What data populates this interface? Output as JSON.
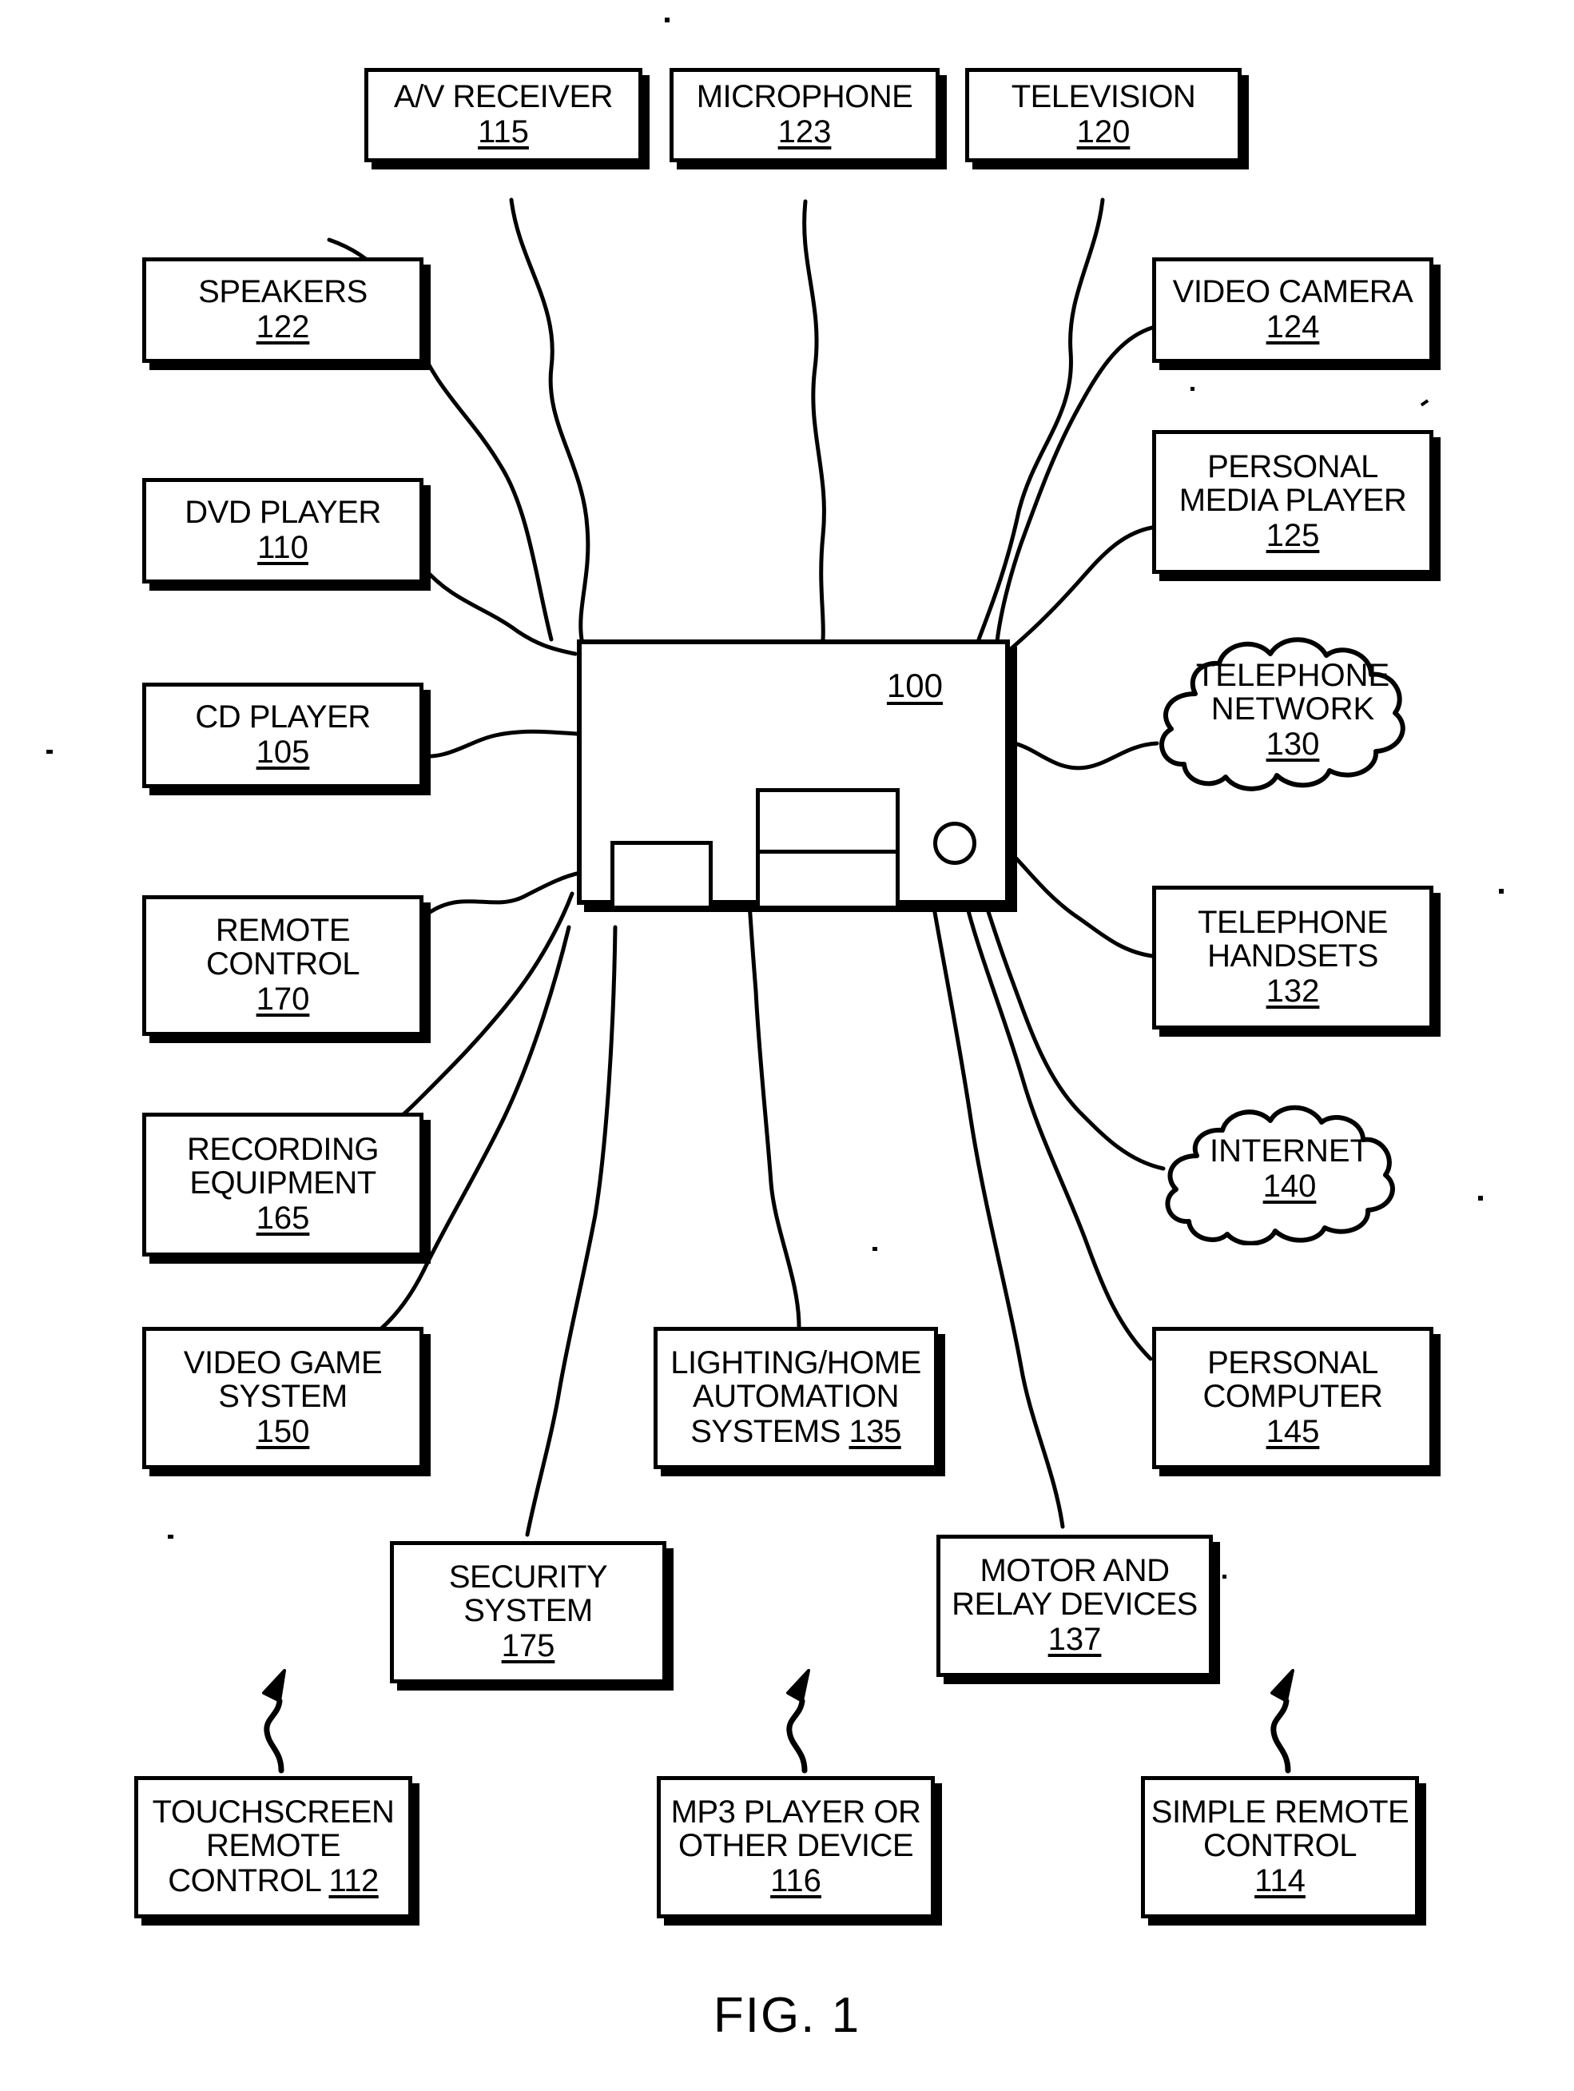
{
  "figure": {
    "caption": "FIG. 1",
    "controller_ref": "100"
  },
  "nodes": [
    {
      "id": "av-receiver",
      "label": "A/V RECEIVER",
      "ref": "115",
      "shape": "box",
      "inline_ref": false
    },
    {
      "id": "microphone",
      "label": "MICROPHONE",
      "ref": "123",
      "shape": "box",
      "inline_ref": false
    },
    {
      "id": "television",
      "label": "TELEVISION",
      "ref": "120",
      "shape": "box",
      "inline_ref": false
    },
    {
      "id": "speakers",
      "label": "SPEAKERS",
      "ref": "122",
      "shape": "box",
      "inline_ref": false
    },
    {
      "id": "dvd-player",
      "label": "DVD PLAYER",
      "ref": "110",
      "shape": "box",
      "inline_ref": false
    },
    {
      "id": "cd-player",
      "label": "CD PLAYER",
      "ref": "105",
      "shape": "box",
      "inline_ref": false
    },
    {
      "id": "remote-control",
      "label": "REMOTE\nCONTROL",
      "ref": "170",
      "shape": "box",
      "inline_ref": false
    },
    {
      "id": "recording-equipment",
      "label": "RECORDING\nEQUIPMENT",
      "ref": "165",
      "shape": "box",
      "inline_ref": false
    },
    {
      "id": "video-game-system",
      "label": "VIDEO GAME\nSYSTEM",
      "ref": "150",
      "shape": "box",
      "inline_ref": false
    },
    {
      "id": "video-camera",
      "label": "VIDEO CAMERA",
      "ref": "124",
      "shape": "box",
      "inline_ref": false
    },
    {
      "id": "personal-media-player",
      "label": "PERSONAL\nMEDIA PLAYER",
      "ref": "125",
      "shape": "box",
      "inline_ref": false
    },
    {
      "id": "telephone-network",
      "label": "TELEPHONE\nNETWORK",
      "ref": "130",
      "shape": "cloud",
      "inline_ref": false
    },
    {
      "id": "telephone-handsets",
      "label": "TELEPHONE\nHANDSETS",
      "ref": "132",
      "shape": "box",
      "inline_ref": false
    },
    {
      "id": "internet",
      "label": "INTERNET",
      "ref": "140",
      "shape": "cloud",
      "inline_ref": false
    },
    {
      "id": "personal-computer",
      "label": "PERSONAL\nCOMPUTER",
      "ref": "145",
      "shape": "box",
      "inline_ref": false
    },
    {
      "id": "lighting-home-automation",
      "label": "LIGHTING/HOME\nAUTOMATION\nSYSTEMS ",
      "ref": "135",
      "shape": "box",
      "inline_ref": true
    },
    {
      "id": "security-system",
      "label": "SECURITY\nSYSTEM",
      "ref": "175",
      "shape": "box",
      "inline_ref": false
    },
    {
      "id": "motor-relay-devices",
      "label": "MOTOR AND\nRELAY DEVICES",
      "ref": "137",
      "shape": "box",
      "inline_ref": false
    },
    {
      "id": "touchscreen-remote-control",
      "label": "TOUCHSCREEN\nREMOTE\nCONTROL ",
      "ref": "112",
      "shape": "box",
      "inline_ref": true
    },
    {
      "id": "mp3-player-other-device",
      "label": "MP3 PLAYER OR\nOTHER DEVICE",
      "ref": "116",
      "shape": "box",
      "inline_ref": false
    },
    {
      "id": "simple-remote-control",
      "label": "SIMPLE REMOTE\nCONTROL",
      "ref": "114",
      "shape": "box",
      "inline_ref": false
    }
  ],
  "colors": {
    "ink": "#000000",
    "paper": "#ffffff"
  }
}
